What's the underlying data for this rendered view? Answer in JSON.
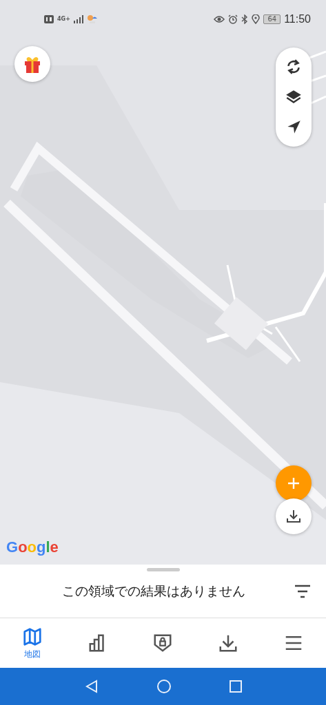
{
  "status_bar": {
    "network": "4G+",
    "battery": "64",
    "time": "11:50"
  },
  "map": {
    "kind": "picture",
    "attribution": "Google"
  },
  "sheet": {
    "message": "この領域での結果はありません"
  },
  "bottom_nav": [
    {
      "label": "地図",
      "selected": true
    },
    {
      "selected": false
    },
    {
      "selected": false
    },
    {
      "selected": false
    },
    {
      "selected": false
    }
  ]
}
